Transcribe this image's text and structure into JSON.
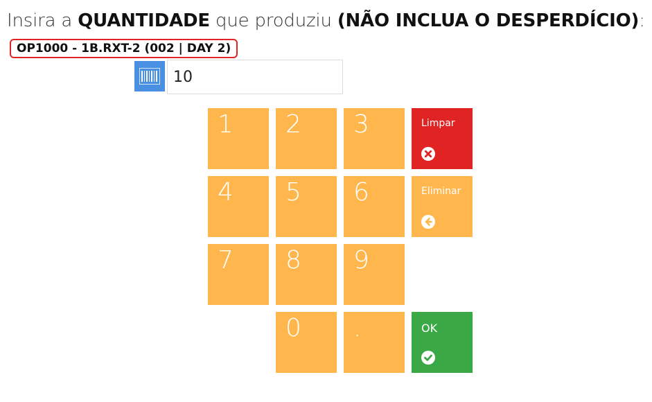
{
  "header": {
    "prefix": "Insira a ",
    "quantity_word": "QUANTIDADE",
    "middle": " que produziu ",
    "exclusion_note": "(NÃO INCLUA O DESPERDÍCIO)",
    "suffix": ":"
  },
  "order": {
    "label": "OP1000 - 1B.RXT-2 (002 | DAY 2)"
  },
  "input": {
    "icon": "barcode-icon",
    "value": "10"
  },
  "keypad": {
    "keys": [
      "1",
      "2",
      "3",
      "4",
      "5",
      "6",
      "7",
      "8",
      "9",
      "0",
      "."
    ],
    "clear_label": "Limpar",
    "clear_icon": "times-circle-icon",
    "delete_label": "Eliminar",
    "delete_icon": "arrow-left-circle-icon",
    "ok_label": "OK",
    "ok_icon": "check-circle-icon"
  },
  "colors": {
    "numeric_key": "#ffb74d",
    "clear_key": "#e02424",
    "ok_key": "#3aa845",
    "barcode_button": "#4a90e2",
    "order_border": "#e02424"
  }
}
